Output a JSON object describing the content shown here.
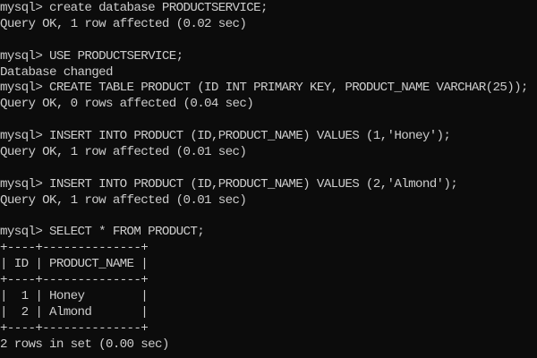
{
  "terminal": {
    "lines": [
      "mysql> create database PRODUCTSERVICE;",
      "Query OK, 1 row affected (0.02 sec)",
      "",
      "mysql> USE PRODUCTSERVICE;",
      "Database changed",
      "mysql> CREATE TABLE PRODUCT (ID INT PRIMARY KEY, PRODUCT_NAME VARCHAR(25));",
      "Query OK, 0 rows affected (0.04 sec)",
      "",
      "mysql> INSERT INTO PRODUCT (ID,PRODUCT_NAME) VALUES (1,'Honey');",
      "Query OK, 1 row affected (0.01 sec)",
      "",
      "mysql> INSERT INTO PRODUCT (ID,PRODUCT_NAME) VALUES (2,'Almond');",
      "Query OK, 1 row affected (0.01 sec)",
      "",
      "mysql> SELECT * FROM PRODUCT;",
      "+----+--------------+",
      "| ID | PRODUCT_NAME |",
      "+----+--------------+",
      "|  1 | Honey        |",
      "|  2 | Almond       |",
      "+----+--------------+",
      "2 rows in set (0.00 sec)"
    ]
  },
  "colors": {
    "background": "#0c0c0c",
    "text": "#cccccc"
  }
}
